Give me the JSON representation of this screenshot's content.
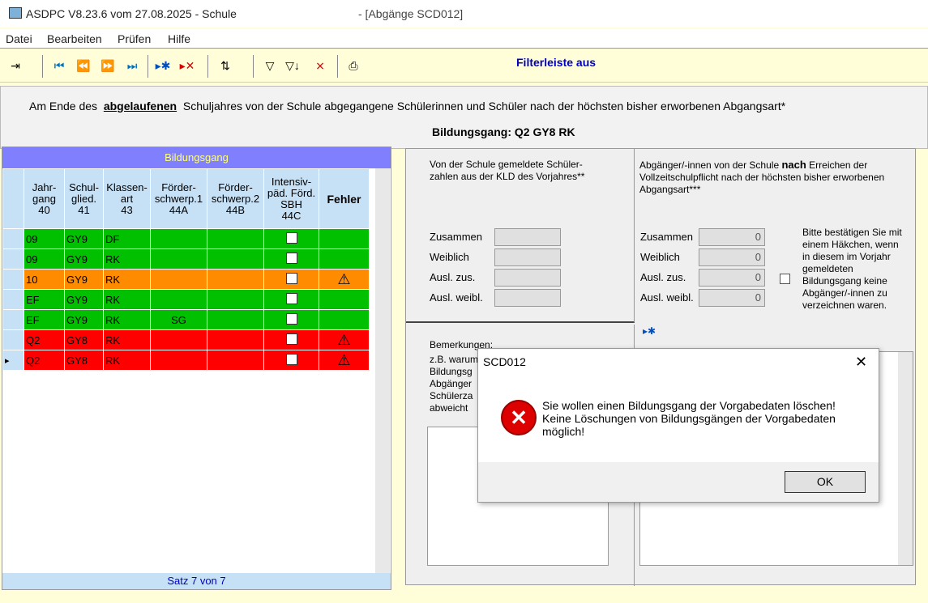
{
  "window": {
    "title": "ASDPC V8.23.6 vom 27.08.2025 - Schule",
    "subtitle": "- [Abgänge SCD012]"
  },
  "menu": [
    "Datei",
    "Bearbeiten",
    "Prüfen",
    "Hilfe"
  ],
  "toolbar": {
    "filter_label": "Filterleiste aus"
  },
  "heading": {
    "line1_pre": "Am Ende des",
    "line1_em": "abgelaufenen",
    "line1_post": "Schuljahres von der Schule abgegangene Schülerinnen und Schüler nach der höchsten bisher erworbenen Abgangsart*",
    "line2": "Bildungsgang: Q2 GY8 RK"
  },
  "grid": {
    "title": "Bildungsgang",
    "headers": [
      [
        "Jahr-",
        "gang",
        "40"
      ],
      [
        "Schul-",
        "glied.",
        "41"
      ],
      [
        "Klassen-",
        "art",
        "43"
      ],
      [
        "Förder-",
        "schwerp.1",
        "44A"
      ],
      [
        "Förder-",
        "schwerp.2",
        "44B"
      ],
      [
        "Intensiv-",
        "päd. Förd.",
        "SBH",
        "44C"
      ],
      [
        "Fehler"
      ]
    ],
    "rows": [
      {
        "c": [
          "09",
          "GY9",
          "DF",
          "",
          ""
        ],
        "color": "green",
        "error": false,
        "selected": false
      },
      {
        "c": [
          "09",
          "GY9",
          "RK",
          "",
          ""
        ],
        "color": "green",
        "error": false,
        "selected": false
      },
      {
        "c": [
          "10",
          "GY9",
          "RK",
          "",
          ""
        ],
        "color": "orange",
        "error": true,
        "selected": false
      },
      {
        "c": [
          "EF",
          "GY9",
          "RK",
          "",
          ""
        ],
        "color": "green",
        "error": false,
        "selected": false
      },
      {
        "c": [
          "EF",
          "GY9",
          "RK",
          "SG",
          ""
        ],
        "color": "green",
        "error": false,
        "selected": false
      },
      {
        "c": [
          "Q2",
          "GY8",
          "RK",
          "",
          ""
        ],
        "color": "red",
        "error": true,
        "selected": false
      },
      {
        "c": [
          "Q2",
          "GY8",
          "RK",
          "",
          ""
        ],
        "color": "red",
        "error": true,
        "selected": true
      }
    ],
    "footer": "Satz 7 von 7"
  },
  "left_box": {
    "heading": "Von der Schule gemeldete Schüler-zahlen aus der KLD des Vorjahres**",
    "fields": [
      "Zusammen",
      "Weiblich",
      "Ausl. zus.",
      "Ausl. weibl."
    ]
  },
  "right_box": {
    "heading_pre": "Abgänger/-innen von der Schule",
    "heading_bold": "nach",
    "heading_post": "Erreichen der Vollzeitschulpflicht nach der höchsten bisher erworbenen Abgangsart***",
    "fields": [
      {
        "label": "Zusammen",
        "value": "0"
      },
      {
        "label": "Weiblich",
        "value": "0"
      },
      {
        "label": "Ausl. zus.",
        "value": "0"
      },
      {
        "label": "Ausl. weibl.",
        "value": "0"
      }
    ],
    "confirm_text": "Bitte bestätigen Sie mit einem Häkchen, wenn in diesem im Vorjahr gemeldeten Bildungsgang keine Abgänger/-innen zu verzeichnen waren."
  },
  "remarks": {
    "title": "Bemerkungen:",
    "text": "z.B. warum Bildungsg Abgänger Schülerza abweicht"
  },
  "dialog": {
    "title": "SCD012",
    "message1": "Sie wollen einen Bildungsgang der Vorgabedaten löschen!",
    "message2": "Keine Löschungen von Bildungsgängen der Vorgabedaten",
    "message3": "möglich!",
    "ok": "OK"
  }
}
